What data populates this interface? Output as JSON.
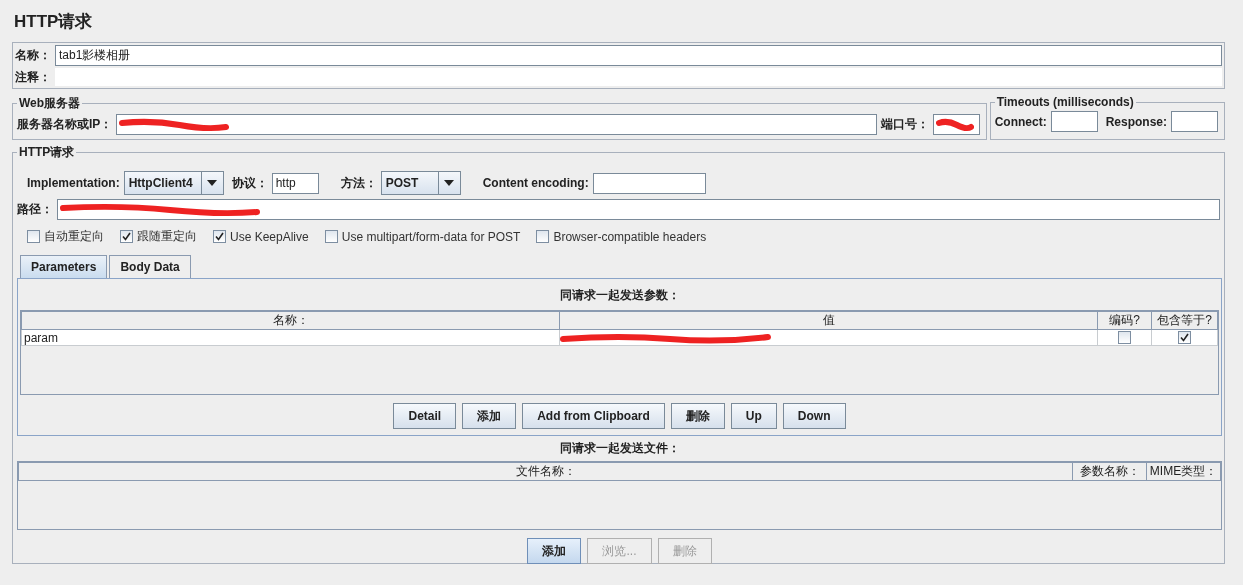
{
  "title": "HTTP请求",
  "name_field": {
    "label": "名称：",
    "value": "tab1影楼相册"
  },
  "comments_field": {
    "label": "注释："
  },
  "web_server": {
    "legend": "Web服务器",
    "server_label": "服务器名称或IP：",
    "server_redacted": true,
    "port_label": "端口号：",
    "port_redacted": true
  },
  "timeouts": {
    "legend": "Timeouts (milliseconds)",
    "connect_label": "Connect:",
    "response_label": "Response:"
  },
  "http_request": {
    "legend": "HTTP请求",
    "implementation_label": "Implementation:",
    "implementation": "HttpClient4",
    "protocol_label": "协议：",
    "protocol": "http",
    "method_label": "方法：",
    "method": "POST",
    "encoding_label": "Content encoding:",
    "path_label": "路径：",
    "path_redacted": true,
    "options": [
      {
        "label": "自动重定向",
        "checked": false
      },
      {
        "label": "跟随重定向",
        "checked": true
      },
      {
        "label": "Use KeepAlive",
        "checked": true
      },
      {
        "label": "Use multipart/form-data for POST",
        "checked": false
      },
      {
        "label": "Browser-compatible headers",
        "checked": false
      }
    ]
  },
  "tabs": [
    {
      "label": "Parameters",
      "selected": true
    },
    {
      "label": "Body Data",
      "selected": false
    }
  ],
  "parameters": {
    "heading": "同请求一起发送参数：",
    "columns": [
      "名称：",
      "值",
      "编码?",
      "包含等于?"
    ],
    "rows": [
      {
        "name": "param",
        "value_redacted": true,
        "encode": false,
        "include_equals": true
      }
    ],
    "buttons": [
      {
        "label": "Detail",
        "disabled": false
      },
      {
        "label": "添加",
        "disabled": false
      },
      {
        "label": "Add from Clipboard",
        "disabled": false
      },
      {
        "label": "删除",
        "disabled": false
      },
      {
        "label": "Up",
        "disabled": false
      },
      {
        "label": "Down",
        "disabled": false
      }
    ]
  },
  "files": {
    "heading": "同请求一起发送文件：",
    "columns": [
      "文件名称：",
      "参数名称：",
      "MIME类型："
    ],
    "buttons": [
      {
        "label": "添加",
        "disabled": false,
        "focused": true
      },
      {
        "label": "浏览...",
        "disabled": true,
        "focused": false
      },
      {
        "label": "删除",
        "disabled": true,
        "focused": false
      }
    ]
  }
}
